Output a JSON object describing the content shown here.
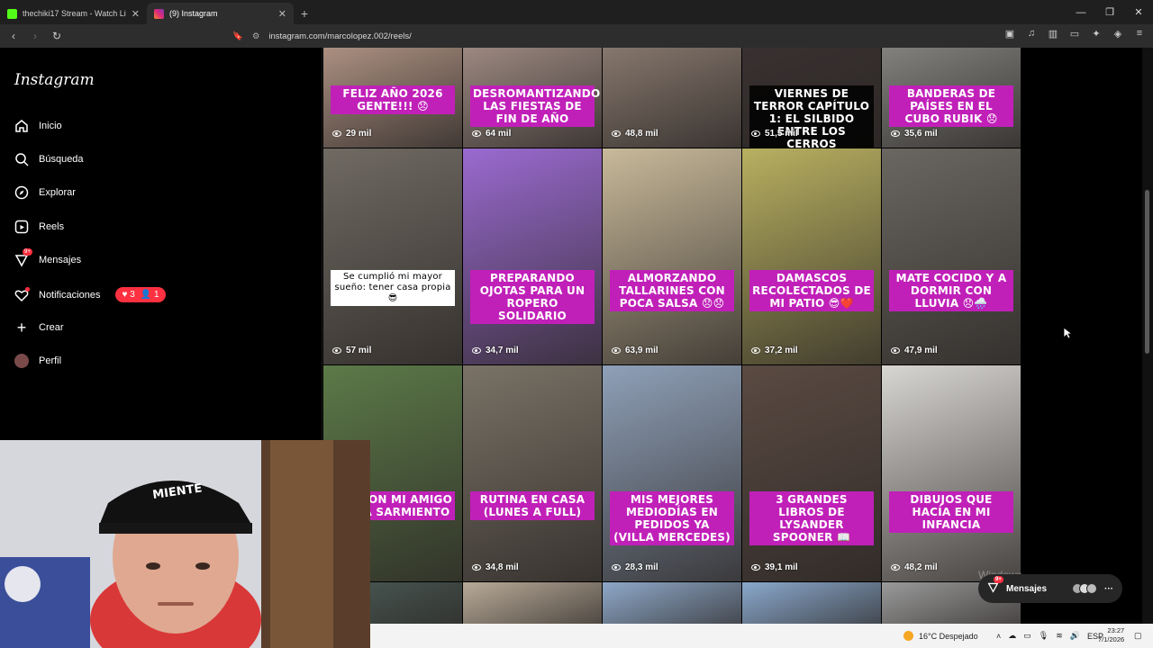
{
  "browser": {
    "tabs": [
      {
        "title": "thechiki17 Stream - Watch Live on Ki",
        "color": "#53fc18",
        "active": false
      },
      {
        "title": "(9) Instagram",
        "color": "#e1306c",
        "active": true
      }
    ],
    "url": "instagram.com/marcolopez.002/reels/"
  },
  "sidebar": {
    "logo": "Instagram",
    "items": [
      {
        "label": "Inicio",
        "icon": "home-icon"
      },
      {
        "label": "Búsqueda",
        "icon": "search-icon"
      },
      {
        "label": "Explorar",
        "icon": "compass-icon"
      },
      {
        "label": "Reels",
        "icon": "reels-icon"
      },
      {
        "label": "Mensajes",
        "icon": "messenger-icon",
        "badge": "9+"
      },
      {
        "label": "Notificaciones",
        "icon": "heart-icon",
        "likes": "3",
        "follows": "1"
      },
      {
        "label": "Crear",
        "icon": "plus-icon"
      },
      {
        "label": "Perfil",
        "icon": "avatar"
      }
    ]
  },
  "reels": [
    {
      "caption": "FELIZ AÑO 2026 GENTE!!! 😞",
      "views": "29 mil",
      "bg": "#b89a8a",
      "style": "pink"
    },
    {
      "caption": "DESROMANTIZANDO LAS FIESTAS DE FIN DE AÑO",
      "views": "64 mil",
      "bg": "#a7928a",
      "style": "pink"
    },
    {
      "caption": "",
      "views": "48,8 mil",
      "bg": "#8f7f74",
      "style": "none"
    },
    {
      "caption": "VIERNES DE TERROR CAPÍTULO 1: EL SILBIDO ENTRE LOS CERROS",
      "views": "51,5 mil",
      "bg": "#3a3232",
      "style": "black"
    },
    {
      "caption": "BANDERAS DE PAÍSES EN EL CUBO RUBIK 😞",
      "views": "35,6 mil",
      "bg": "#8a8a86",
      "style": "pink"
    },
    {
      "caption": "Se cumplió mi mayor sueño: tener casa propia 😎",
      "views": "57 mil",
      "bg": "#6f6a62",
      "style": "white"
    },
    {
      "caption": "PREPARANDO OJOTAS PARA UN ROPERO SOLIDARIO",
      "views": "34,7 mil",
      "bg": "#9a6ad0",
      "style": "pink"
    },
    {
      "caption": "ALMORZANDO TALLARINES CON POCA SALSA 😞😞",
      "views": "63,9 mil",
      "bg": "#c8b99a",
      "style": "pink"
    },
    {
      "caption": "DAMASCOS RECOLECTADOS DE MI PATIO 😎❤️",
      "views": "37,2 mil",
      "bg": "#b8b060",
      "style": "pink"
    },
    {
      "caption": "MATE COCIDO Y A DORMIR CON LLUVIA 😞🌧️",
      "views": "47,9 mil",
      "bg": "#6a6660",
      "style": "pink"
    },
    {
      "caption": "TES CON MI AMIGO EN LA SARMIENTO",
      "views": "mil",
      "bg": "#5c7a48",
      "style": "pink"
    },
    {
      "caption": "RUTINA EN CASA (LUNES A FULL)",
      "views": "34,8 mil",
      "bg": "#7a7266",
      "style": "pink"
    },
    {
      "caption": "MIS MEJORES MEDIODÍAS EN PEDIDOS YA (VILLA MERCEDES)",
      "views": "28,3 mil",
      "bg": "#8fa0b8",
      "style": "pink"
    },
    {
      "caption": "3 GRANDES LIBROS DE LYSANDER SPOONER 📖",
      "views": "39,1 mil",
      "bg": "#5a4a42",
      "style": "pink"
    },
    {
      "caption": "DIBUJOS QUE HACÍA EN MI INFANCIA",
      "views": "48,2 mil",
      "bg": "#d8d6d2",
      "style": "pink"
    },
    {
      "caption": "",
      "views": "",
      "bg": "#4a5a55",
      "style": "none"
    },
    {
      "caption": "",
      "views": "",
      "bg": "#b8aa98",
      "style": "none"
    },
    {
      "caption": "",
      "views": "",
      "bg": "#8ea8c8",
      "style": "none"
    },
    {
      "caption": "",
      "views": "",
      "bg": "#8aa8cc",
      "style": "none"
    },
    {
      "caption": "",
      "views": "",
      "bg": "#9a9a9a",
      "style": "none"
    }
  ],
  "floating_messages": {
    "label": "Mensajes",
    "badge": "9+"
  },
  "watermark": "Windows",
  "taskbar": {
    "weather": "16°C  Despejado",
    "lang": "ESP",
    "time": "23:27",
    "date": "7/1/2026"
  }
}
